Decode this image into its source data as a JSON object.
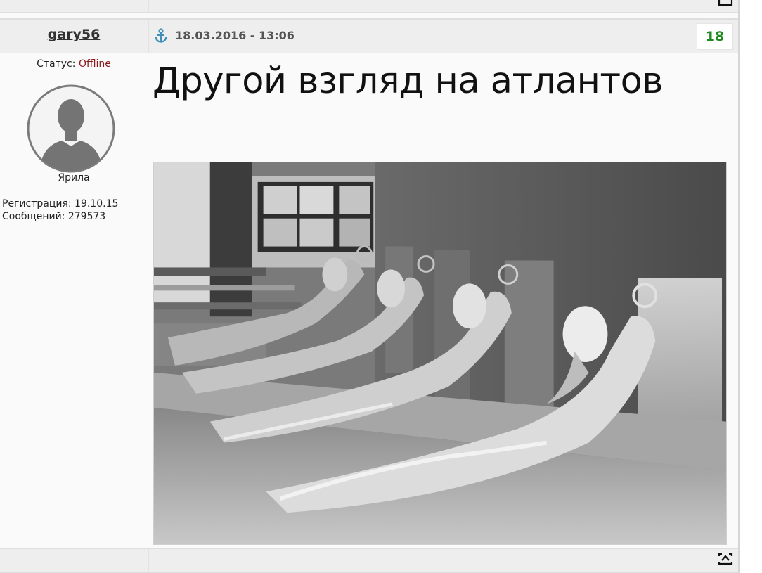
{
  "post": {
    "author": {
      "username": "gary56",
      "status_label": "Статус:",
      "status_value": "Offline",
      "rank": "Ярила",
      "registration": "Регистрация: 19.10.15",
      "messages": "Сообщений: 279573"
    },
    "header": {
      "datetime": "18.03.2016 - 13:06",
      "post_number": "18"
    },
    "title": "Другой взгляд на атлантов"
  },
  "icons": {
    "anchor": "anchor-icon",
    "to_top": "back-to-top-icon",
    "avatar": "default-user-avatar-icon"
  },
  "colors": {
    "offline": "#8b1a1a",
    "post_number": "#1f8a1f",
    "anchor": "#3f8fb8"
  }
}
